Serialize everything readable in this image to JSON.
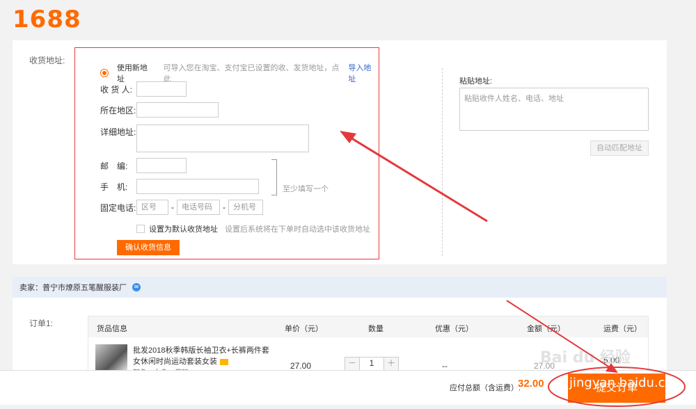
{
  "logo": "1688",
  "address": {
    "section_label": "收货地址:",
    "use_new": "使用新地址",
    "import_hint": "可导入您在淘宝、支付宝已设置的收、发货地址，点此",
    "import_link": "导入地址",
    "fields": {
      "receiver": "收 货 人:",
      "region": "所在地区:",
      "detail": "详细地址:",
      "postcode": "邮　编:",
      "mobile": "手　机:",
      "phone": "固定电话:"
    },
    "phone_placeholders": {
      "area": "区号",
      "number": "电话号码",
      "ext": "分机号"
    },
    "dash": "-",
    "fill_one_hint": "至少填写一个",
    "default_label": "设置为默认收货地址",
    "default_hint": "设置后系统将在下单时自动选中该收货地址",
    "confirm_button": "确认收货信息",
    "paste_label": "粘贴地址:",
    "paste_placeholder": "粘贴收件人姓名、电话、地址",
    "auto_match_button": "自动匹配地址"
  },
  "seller": {
    "label": "卖家：普宁市燎原五笔醒服装厂",
    "icon": "ww-icon"
  },
  "order": {
    "label": "订单1:",
    "headers": [
      "货品信息",
      "单价（元）",
      "数量",
      "优惠（元）",
      "金额（元）",
      "运费（元）"
    ],
    "item": {
      "title_line1": "批发2018秋季韩版长袖卫衣+长裤两件套",
      "title_line2": "女休闲时尚运动套装女装",
      "props": "颜色：白色　尺码：M",
      "price": "27.00",
      "quantity": "1",
      "minus": "－",
      "plus": "＋",
      "discount": "--",
      "amount": "27.00",
      "shipping": "5.00"
    }
  },
  "footer": {
    "total_label": "应付总额（含运费）:",
    "total_value": "32.00",
    "submit_button": "提交订单"
  },
  "watermark": {
    "site": "jingyan.baidu.com",
    "logo": "Bai du 经验"
  },
  "colors": {
    "accent": "#ff6a00",
    "annotation": "#e4393c"
  }
}
